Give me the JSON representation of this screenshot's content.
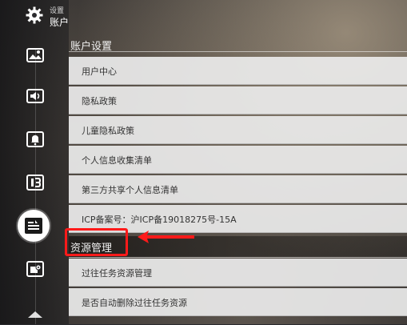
{
  "header": {
    "breadcrumb_parent": "设置",
    "breadcrumb_current": "账户"
  },
  "sidebar": {
    "icons": [
      "image-settings-icon",
      "sound-icon",
      "notification-bell-icon",
      "controls-icon",
      "account-icon",
      "cache-icon",
      "scroll-up-icon"
    ],
    "active": "account-icon"
  },
  "sections": {
    "account": {
      "title": "账户设置",
      "items": [
        "用户中心",
        "隐私政策",
        "儿童隐私政策",
        "个人信息收集清单",
        "第三方共享个人信息清单",
        "ICP备案号：沪ICP备19018275号-15A"
      ]
    },
    "resources": {
      "title": "资源管理",
      "items": [
        "过往任务资源管理",
        "是否自动删除过往任务资源"
      ]
    }
  },
  "colors": {
    "highlight": "#ff1a1a",
    "row_bg": "#ebebeb",
    "text_dark": "#333333"
  }
}
